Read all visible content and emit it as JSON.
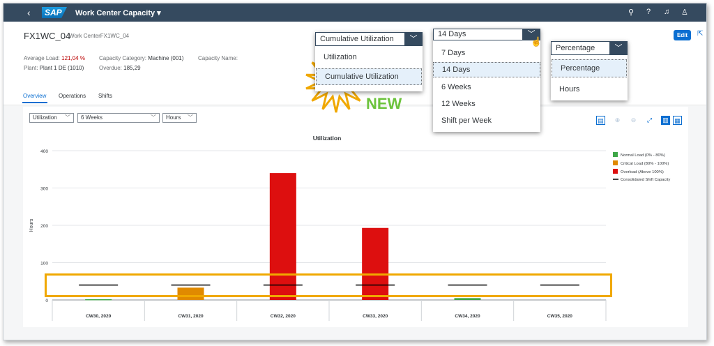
{
  "shell": {
    "back_icon": "‹",
    "logo_text": "SAP",
    "app_title": "Work Center Capacity ▾",
    "icons": [
      "search-icon",
      "help-icon",
      "bell-icon",
      "user-icon"
    ],
    "icon_glyphs": [
      "⚲",
      "?",
      "♫",
      "♙"
    ]
  },
  "header": {
    "title": "FX1WC_04",
    "subtitle": "Work CenterFX1WC_04",
    "average_load_label": "Average Load:",
    "average_load_value": "121,04 %",
    "capacity_category_label": "Capacity Category:",
    "capacity_category_value": "Machine (001)",
    "capacity_name_label": "Capacity Name:",
    "plant_label": "Plant:",
    "plant_value": "Plant 1 DE (1010)",
    "overdue_label": "Overdue:",
    "overdue_value": "185,29",
    "edit_label": "Edit"
  },
  "tabs": [
    {
      "label": "Overview",
      "active": true
    },
    {
      "label": "Operations",
      "active": false
    },
    {
      "label": "Shifts",
      "active": false
    }
  ],
  "toolbar": {
    "view_select": "Utilization",
    "period_select": "6 Weeks",
    "unit_select": "Hours",
    "icons": [
      "legend-icon",
      "zoom-in-icon",
      "zoom-out-icon",
      "fullscreen-icon",
      "chart-view-icon",
      "table-view-icon"
    ]
  },
  "popover_view": {
    "selected": "Cumulative Utilization",
    "items": [
      "Utilization",
      "Cumulative Utilization"
    ],
    "selected_index": 1
  },
  "popover_period": {
    "selected": "14 Days",
    "items": [
      "7 Days",
      "14 Days",
      "6 Weeks",
      "12 Weeks",
      "Shift per Week"
    ],
    "selected_index": 1
  },
  "popover_unit": {
    "selected": "Percentage",
    "items": [
      "Percentage",
      "Hours"
    ],
    "selected_index": 0
  },
  "callout": "NEW",
  "colors": {
    "shell": "#354a5f",
    "normal": "#3fa748",
    "critical": "#e08a00",
    "overload": "#dd0f0f",
    "highlight": "#f0a800",
    "new_text": "#6cc33c"
  },
  "chart_data": {
    "type": "bar",
    "title": "Utilization",
    "ylabel": "Hours",
    "xlabel": "",
    "ylim": [
      0,
      400
    ],
    "yticks": [
      0,
      100,
      200,
      300,
      400
    ],
    "categories": [
      "CW30, 2020",
      "CW31, 2020",
      "CW32, 2020",
      "CW33, 2020",
      "CW34, 2020",
      "CW35, 2020"
    ],
    "series": [
      {
        "name": "Normal Load (0% - 80%)",
        "color": "#3fa748",
        "values": [
          2,
          0,
          0,
          0,
          5,
          0
        ]
      },
      {
        "name": "Critical Load (80% - 100%)",
        "color": "#e08a00",
        "values": [
          0,
          33,
          0,
          0,
          0,
          0
        ]
      },
      {
        "name": "Overload (Above 100%)",
        "color": "#dd0f0f",
        "values": [
          0,
          0,
          340,
          193,
          0,
          0
        ]
      }
    ],
    "line_series": {
      "name": "Consolidated Shift Capacity",
      "color": "#000000",
      "values": [
        40,
        40,
        40,
        40,
        40,
        40
      ]
    },
    "legend_position": "right"
  }
}
